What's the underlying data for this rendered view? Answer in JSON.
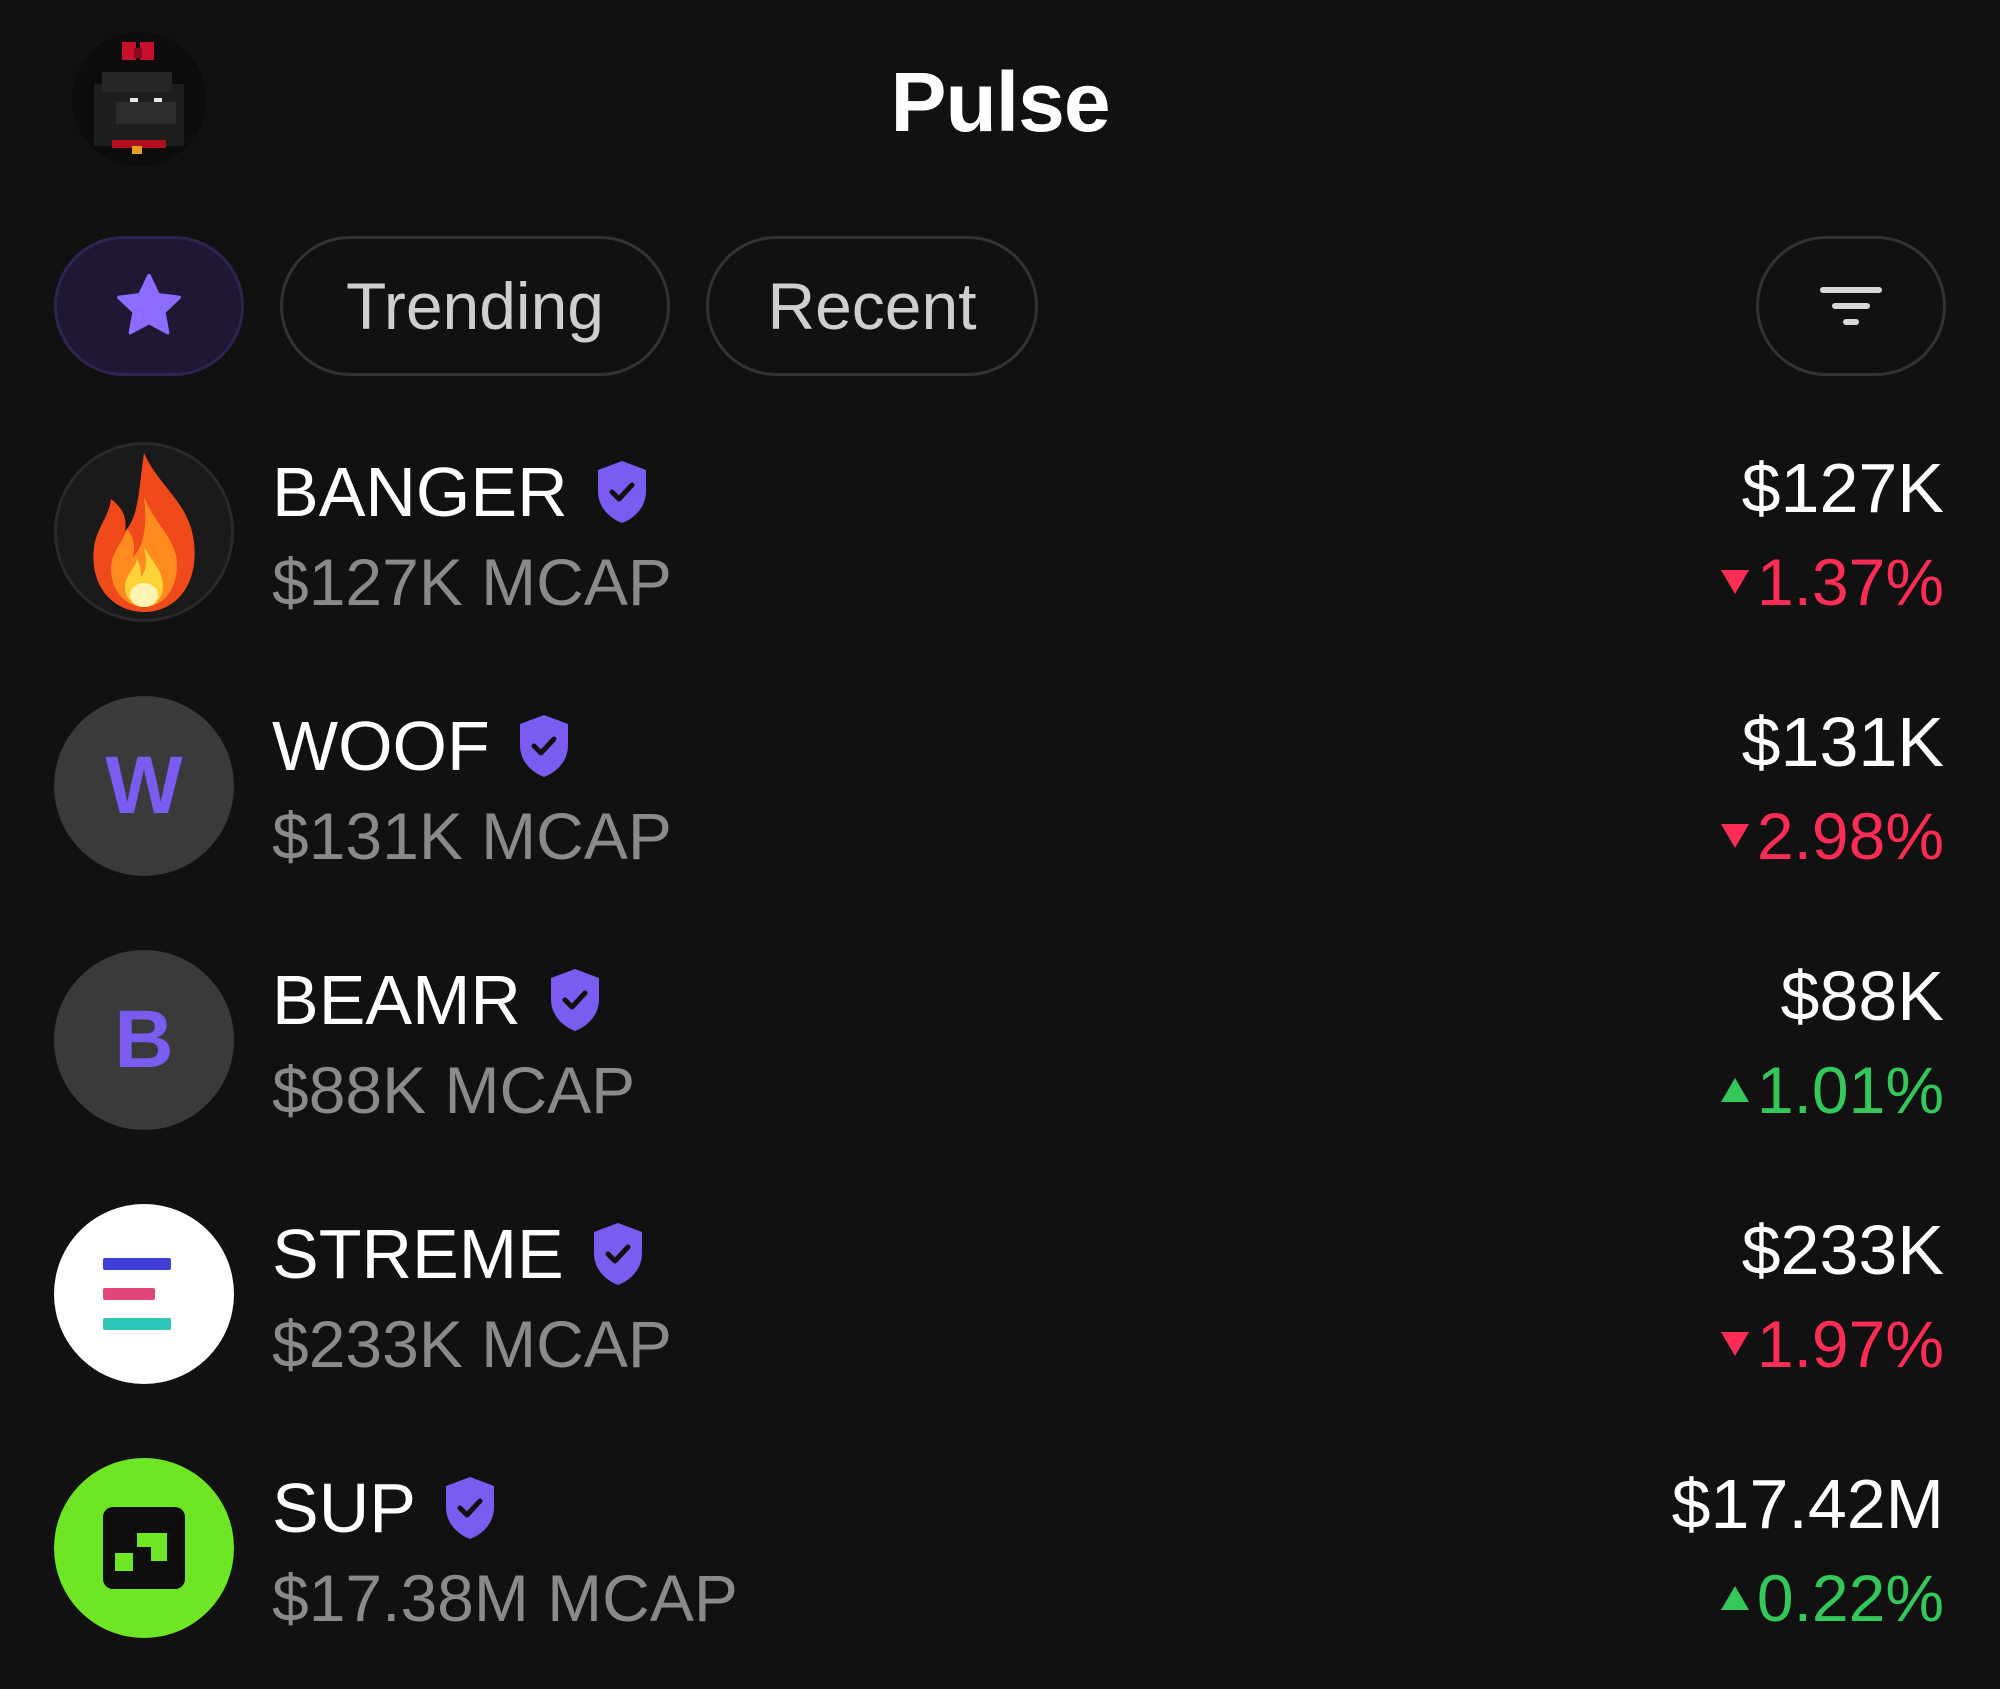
{
  "header": {
    "title": "Pulse"
  },
  "filters": {
    "favorites_icon": "star-icon",
    "trending_label": "Trending",
    "recent_label": "Recent",
    "filter_icon": "filter-icon"
  },
  "colors": {
    "background": "#111111",
    "accent": "#7b5cf0",
    "negative": "#ff2d55",
    "positive": "#34c759",
    "muted_text": "#8a8a8a"
  },
  "tokens": [
    {
      "name": "BANGER",
      "mcap": "$127K MCAP",
      "price": "$127K",
      "change": "1.37%",
      "direction": "down",
      "logo": "fire-icon",
      "verified": true
    },
    {
      "name": "WOOF",
      "mcap": "$131K MCAP",
      "price": "$131K",
      "change": "2.98%",
      "direction": "down",
      "logo_letter": "W",
      "verified": true
    },
    {
      "name": "BEAMR",
      "mcap": "$88K MCAP",
      "price": "$88K",
      "change": "1.01%",
      "direction": "up",
      "logo_letter": "B",
      "verified": true
    },
    {
      "name": "STREME",
      "mcap": "$233K MCAP",
      "price": "$233K",
      "change": "1.97%",
      "direction": "down",
      "logo": "streme-logo",
      "verified": true
    },
    {
      "name": "SUP",
      "mcap": "$17.38M MCAP",
      "price": "$17.42M",
      "change": "0.22%",
      "direction": "up",
      "logo": "sup-logo",
      "verified": true
    }
  ]
}
